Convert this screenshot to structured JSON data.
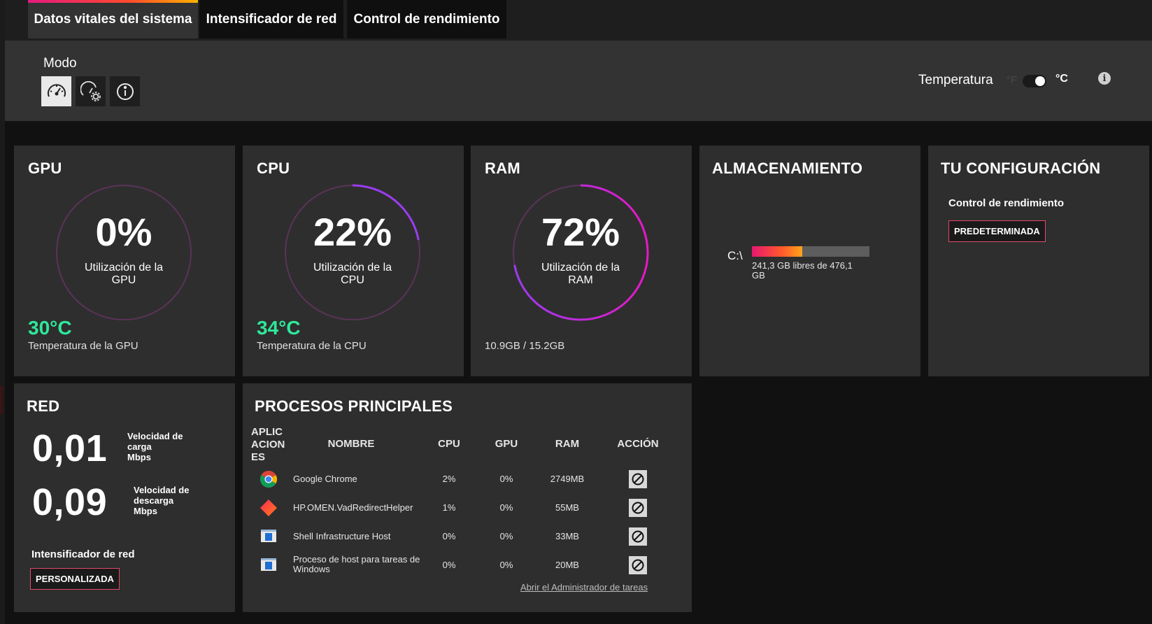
{
  "tabs": [
    {
      "label": "Datos vitales del sistema",
      "active": true
    },
    {
      "label": "Intensificador de red",
      "active": false
    },
    {
      "label": "Control de rendimiento",
      "active": false
    }
  ],
  "header": {
    "mode_label": "Modo",
    "mode_icons": [
      "speedometer-icon",
      "speedometer-gear-icon",
      "info-icon"
    ],
    "temperature_label": "Temperatura",
    "unit_f": "°F",
    "unit_c": "°C",
    "unit_selected": "°C",
    "info_glyph": "i"
  },
  "gpu": {
    "title": "GPU",
    "percent": "0%",
    "percent_value": 0,
    "subtitle": "Utilización de la GPU",
    "temp": "30°C",
    "temp_label": "Temperatura de la GPU"
  },
  "cpu": {
    "title": "CPU",
    "percent": "22%",
    "percent_value": 22,
    "subtitle": "Utilización de la CPU",
    "temp": "34°C",
    "temp_label": "Temperatura de la CPU"
  },
  "ram": {
    "title": "RAM",
    "percent": "72%",
    "percent_value": 72,
    "subtitle": "Utilización de la RAM",
    "usage": "10.9GB / 15.2GB"
  },
  "storage": {
    "title": "ALMACENAMIENTO",
    "drive": "C:\\",
    "used_fraction": 0.43,
    "free_text": "241,3 GB libres de 476,1 GB"
  },
  "config": {
    "title": "TU CONFIGURACIÓN",
    "sub_label": "Control de rendimiento",
    "badge": "PREDETERMINADA"
  },
  "network": {
    "title": "RED",
    "upload_value": "0,01",
    "upload_label": "Velocidad de carga",
    "upload_unit": "Mbps",
    "download_value": "0,09",
    "download_label": "Velocidad de descarga",
    "download_unit": "Mbps",
    "booster_label": "Intensificador de red",
    "booster_badge": "PERSONALIZADA"
  },
  "processes": {
    "title": "PROCESOS PRINCIPALES",
    "headers": {
      "apps": "APLIC ACION ES",
      "name": "NOMBRE",
      "cpu": "CPU",
      "gpu": "GPU",
      "ram": "RAM",
      "action": "ACCIÓN"
    },
    "rows": [
      {
        "icon": "chrome-icon",
        "name": "Google Chrome",
        "cpu": "2%",
        "gpu": "0%",
        "ram": "2749MB"
      },
      {
        "icon": "hp-omen-icon",
        "name": "HP.OMEN.VadRedirectHelper",
        "cpu": "1%",
        "gpu": "0%",
        "ram": "55MB"
      },
      {
        "icon": "windows-app-icon",
        "name": "Shell Infrastructure Host",
        "cpu": "0%",
        "gpu": "0%",
        "ram": "33MB"
      },
      {
        "icon": "windows-app-icon",
        "name": "Proceso de host para tareas de Windows",
        "cpu": "0%",
        "gpu": "0%",
        "ram": "20MB"
      }
    ],
    "task_manager_link": "Abrir el Administrador de tareas"
  },
  "colors": {
    "accent_green": "#2ee89a",
    "gauge_purple": "#9b3cf0",
    "gauge_magenta": "#e618c8",
    "badge_border": "#e34a6b"
  }
}
